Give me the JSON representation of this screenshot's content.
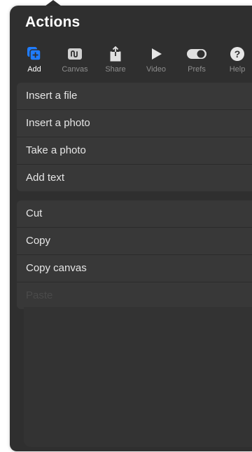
{
  "panel": {
    "title": "Actions"
  },
  "tabs": [
    {
      "label": "Add",
      "icon": "add-icon",
      "active": true
    },
    {
      "label": "Canvas",
      "icon": "canvas-icon",
      "active": false
    },
    {
      "label": "Share",
      "icon": "share-icon",
      "active": false
    },
    {
      "label": "Video",
      "icon": "video-play-icon",
      "active": false
    },
    {
      "label": "Prefs",
      "icon": "toggle-icon",
      "active": false
    },
    {
      "label": "Help",
      "icon": "help-icon",
      "active": false
    }
  ],
  "add_group": {
    "items": [
      {
        "label": "Insert a file"
      },
      {
        "label": "Insert a photo"
      },
      {
        "label": "Take a photo"
      },
      {
        "label": "Add text"
      }
    ]
  },
  "edit_group": {
    "items": [
      {
        "label": "Cut"
      },
      {
        "label": "Copy"
      },
      {
        "label": "Copy canvas"
      },
      {
        "label": "Paste",
        "disabled": true
      }
    ]
  },
  "colors": {
    "accent": "#1f7cff",
    "panel_bg": "#2f2f2f",
    "row_bg": "#383838",
    "text": "#e6e6e6",
    "muted": "#8e8e8e"
  }
}
